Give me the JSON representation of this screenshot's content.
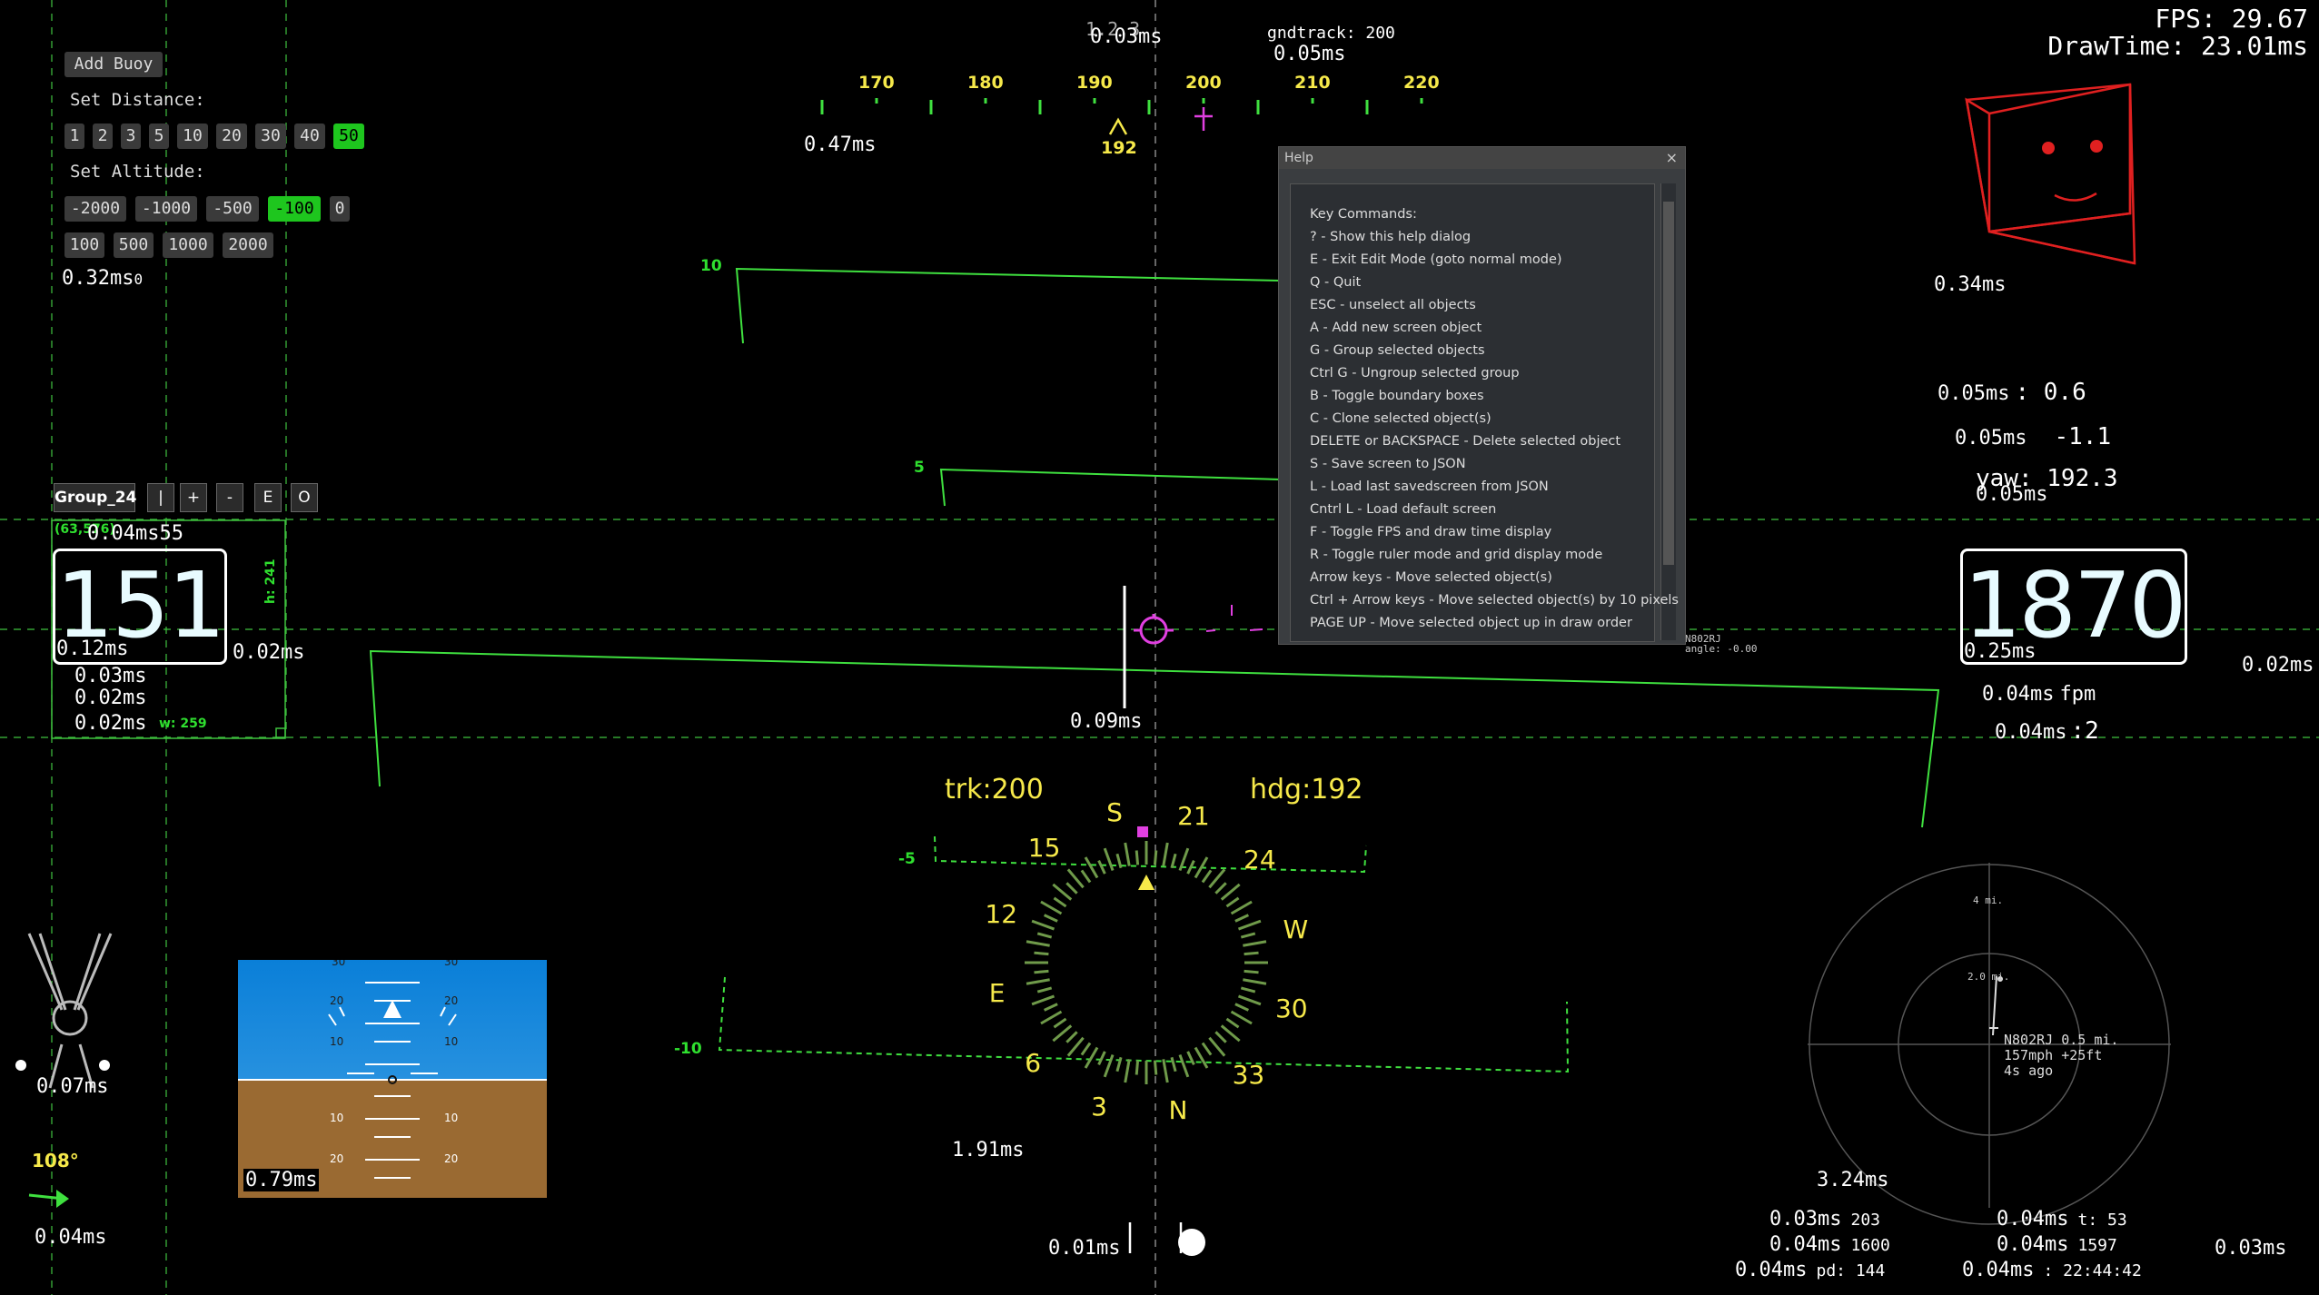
{
  "stats": {
    "fps": "FPS: 29.67",
    "drawtime": "DrawTime: 23.01ms"
  },
  "buoy": {
    "add_label": "Add Buoy",
    "set_distance_label": "Set Distance:",
    "distances": [
      "1",
      "2",
      "3",
      "5",
      "10",
      "20",
      "30",
      "40",
      "50"
    ],
    "distance_selected": "50",
    "set_altitude_label": "Set Altitude:",
    "altitudes_row1": [
      "-2000",
      "-1000",
      "-500",
      "-100",
      "0"
    ],
    "altitude_selected": "-100",
    "altitudes_row2": [
      "100",
      "500",
      "1000",
      "2000"
    ],
    "time": "0.32ms",
    "time_suffix": "0"
  },
  "toolbar": {
    "group_name": "Group_24",
    "buttons": [
      "|",
      "+",
      "-",
      "E",
      "O"
    ]
  },
  "heading_tape": {
    "labels": [
      "170",
      "180",
      "190",
      "200",
      "210",
      "220"
    ],
    "current": "192",
    "time": "0.47ms",
    "top_time": "0.03ms",
    "top_overlap": "1.2.3",
    "gndtrack": "gndtrack: 200",
    "gndtrack_time": "0.05ms"
  },
  "pitch_ladder": {
    "labels_pos": [
      "10",
      "5"
    ],
    "labels_neg": [
      "-5",
      "-10"
    ]
  },
  "help": {
    "title": "Help",
    "close": "×",
    "header": "Key Commands:",
    "lines": [
      "? - Show this help dialog",
      "E - Exit Edit Mode (goto normal mode)",
      "Q - Quit",
      "ESC - unselect all objects",
      "A - Add new screen object",
      "G - Group selected objects",
      "Ctrl G - Ungroup selected group",
      "B - Toggle boundary boxes",
      "C - Clone selected object(s)",
      "DELETE or BACKSPACE - Delete selected object",
      "S - Save screen to JSON",
      "L - Load last savedscreen from JSON",
      "Cntrl L - Load default screen",
      "F - Toggle FPS and draw time display",
      "R - Toggle ruler mode and grid display mode",
      "Arrow keys - Move selected object(s)",
      "Ctrl + Arrow keys - Move selected object(s) by 10 pixels",
      "PAGE UP - Move selected object up in draw order"
    ]
  },
  "airspeed": {
    "value": "151",
    "coords": "(63,576)",
    "overlap": "55",
    "time_top": "0.04ms",
    "time_box": "0.12ms",
    "time_right": "0.02ms",
    "times_below": [
      "0.03ms",
      "0.02ms",
      "0.02ms"
    ],
    "width_label": "w: 259",
    "height_label": "h: 241"
  },
  "altitude": {
    "value": "1870",
    "time": "0.25ms",
    "vs_time": "0.04ms",
    "vs_unit": "fpm",
    "g_time": "0.04ms",
    "g_value": ":2",
    "edge_time": "0.02ms"
  },
  "attitude_data": {
    "roll_label": ": 0.6",
    "roll_time": "0.05ms",
    "pitch_label": "-1.1",
    "pitch_time": "0.05ms",
    "yaw_label": "yaw: 192.3",
    "yaw_time": "0.05ms"
  },
  "cube": {
    "time": "0.34ms"
  },
  "center": {
    "time": "0.09ms",
    "angle_text": "angle: -0.00",
    "callsign_text": "N802RJ"
  },
  "compass": {
    "trk": "trk:200",
    "hdg": "hdg:192",
    "labels": [
      "N",
      "3",
      "6",
      "E",
      "12",
      "15",
      "S",
      "21",
      "24",
      "W",
      "30",
      "33"
    ],
    "time": "1.91ms"
  },
  "adi": {
    "pitch_labels": [
      "30",
      "20",
      "10",
      "10",
      "20",
      "30"
    ],
    "time": "0.79ms"
  },
  "turn": {
    "time": "0.07ms",
    "wind": "108°",
    "wind_time": "0.04ms"
  },
  "bottom": {
    "time_left": "0.01ms"
  },
  "traffic": {
    "ring_outer": "4 mi.",
    "ring_inner": "2.0 mi.",
    "callsign": "N802RJ 0.5 mi.",
    "speed": "157mph +25ft",
    "ago": "4s ago",
    "time": "3.24ms"
  },
  "bottom_right": {
    "col1": [
      [
        "0.03ms",
        "203"
      ],
      [
        "0.04ms",
        "1600"
      ],
      [
        "0.04ms",
        "pd: 144"
      ]
    ],
    "col2": [
      [
        "0.04ms",
        "t: 53"
      ],
      [
        "0.04ms",
        "1597"
      ],
      [
        "0.04ms",
        ": 22:44:42"
      ]
    ],
    "edge": "0.03ms"
  }
}
